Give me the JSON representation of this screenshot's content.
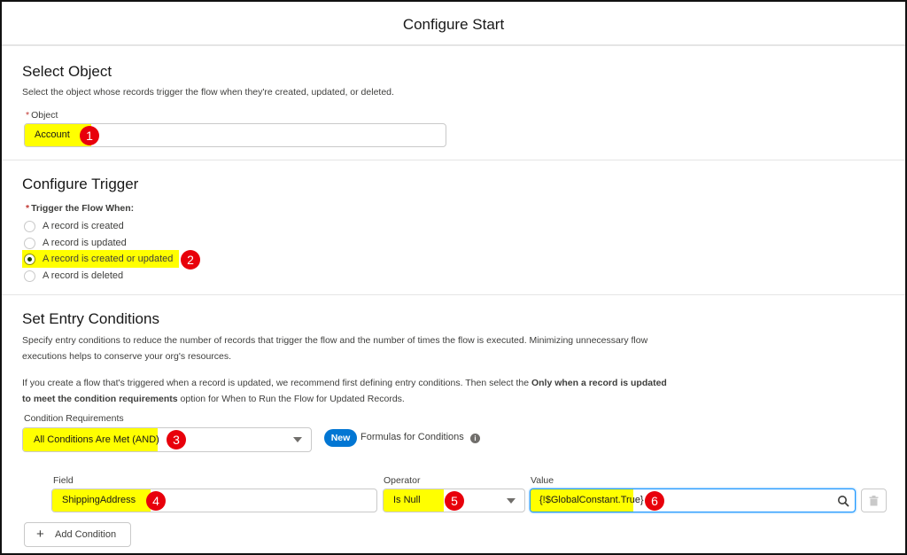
{
  "header": {
    "title": "Configure Start"
  },
  "select_object": {
    "title": "Select Object",
    "description": "Select the object whose records trigger the flow when they're created, updated, or deleted.",
    "object_label": "Object",
    "object_value": "Account",
    "badge": "1"
  },
  "configure_trigger": {
    "title": "Configure Trigger",
    "trigger_label": "Trigger the Flow When:",
    "options": [
      {
        "label": "A record is created",
        "selected": false
      },
      {
        "label": "A record is updated",
        "selected": false
      },
      {
        "label": "A record is created or updated",
        "selected": true
      },
      {
        "label": "A record is deleted",
        "selected": false
      }
    ],
    "badge": "2"
  },
  "entry_conditions": {
    "title": "Set Entry Conditions",
    "description1": "Specify entry conditions to reduce the number of records that trigger the flow and the number of times the flow is executed. Minimizing unnecessary flow executions helps to conserve your org's resources.",
    "description2_pre": "If you create a flow that's triggered when a record is updated, we recommend first defining entry conditions. Then select the ",
    "description2_bold": "Only when a record is updated to meet the condition requirements",
    "description2_post": " option for When to Run the Flow for Updated Records.",
    "requirements_label": "Condition Requirements",
    "requirements_value": "All Conditions Are Met (AND)",
    "requirements_badge": "3",
    "new_pill": "New",
    "formulas_label": "Formulas for Conditions",
    "info_glyph": "i",
    "condition": {
      "field_label": "Field",
      "field_value": "ShippingAddress",
      "field_badge": "4",
      "operator_label": "Operator",
      "operator_value": "Is Null",
      "operator_badge": "5",
      "value_label": "Value",
      "value_value": "{!$GlobalConstant.True}",
      "value_badge": "6"
    },
    "add_condition_label": "Add Condition",
    "add_glyph": "+"
  },
  "colors": {
    "highlight": "#ffff00",
    "badge": "#e8000b",
    "brand": "#0176d3",
    "required": "#c23934"
  }
}
